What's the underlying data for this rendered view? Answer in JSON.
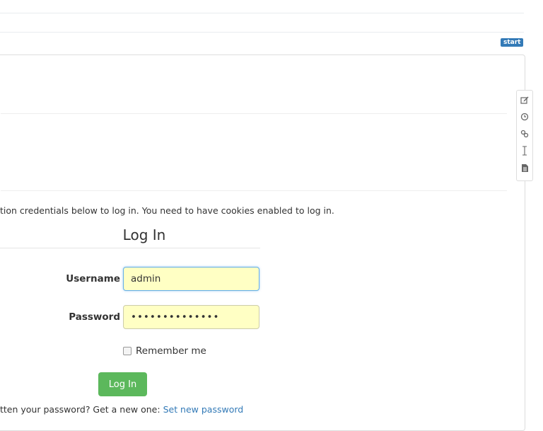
{
  "header": {
    "badge": "start"
  },
  "toolbar": {
    "icons": [
      "edit-icon",
      "history-icon",
      "backlinks-icon",
      "cursor-icon",
      "document-icon"
    ]
  },
  "login": {
    "intro": "tion credentials below to log in. You need to have cookies enabled to log in.",
    "title": "Log In",
    "username_label": "Username",
    "username_value": "admin",
    "password_label": "Password",
    "password_value": "••••••••••••••",
    "remember_label": "Remember me",
    "submit_label": "Log In",
    "forgot_text": "tten your password? Get a new one: ",
    "forgot_link": "Set new password"
  }
}
